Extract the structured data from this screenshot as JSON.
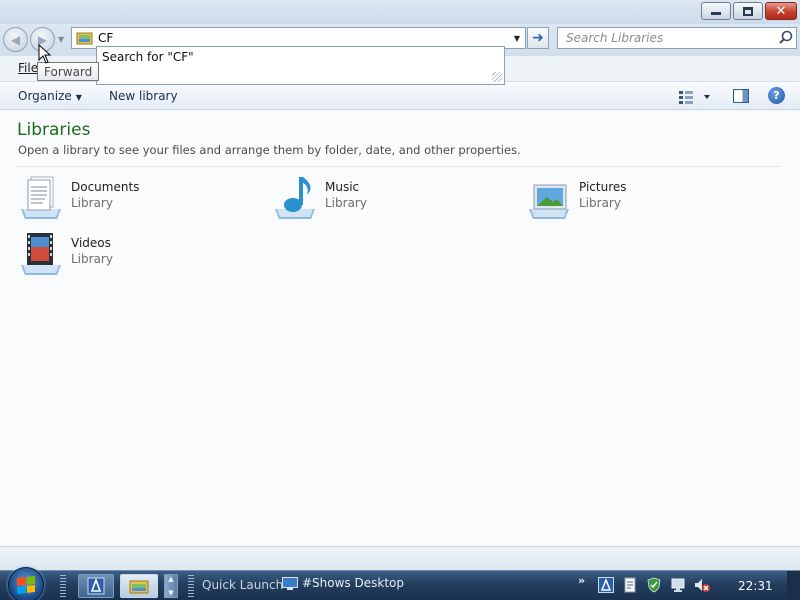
{
  "window": {
    "address_value": "CF",
    "search_placeholder": "Search Libraries"
  },
  "tooltip": {
    "text": "Forward"
  },
  "autocomplete": {
    "suggestion": "Search for \"CF\""
  },
  "menubar": {
    "file_label": "File"
  },
  "commandbar": {
    "organize_label": "Organize",
    "new_library_label": "New library"
  },
  "content": {
    "title": "Libraries",
    "description": "Open a library to see your files and arrange them by folder, date, and other properties.",
    "libraries": [
      {
        "name": "Documents",
        "type": "Library",
        "icon": "documents-library-icon"
      },
      {
        "name": "Music",
        "type": "Library",
        "icon": "music-library-icon"
      },
      {
        "name": "Pictures",
        "type": "Library",
        "icon": "pictures-library-icon"
      },
      {
        "name": "Videos",
        "type": "Library",
        "icon": "videos-library-icon"
      }
    ]
  },
  "taskbar": {
    "quick_launch_label": "Quick Launch",
    "show_desktop_label": "#Shows Desktop",
    "clock": "22:31"
  },
  "colors": {
    "title_green": "#1e6a1e",
    "taskbar": "#233e5e",
    "close_red": "#c4412f"
  }
}
